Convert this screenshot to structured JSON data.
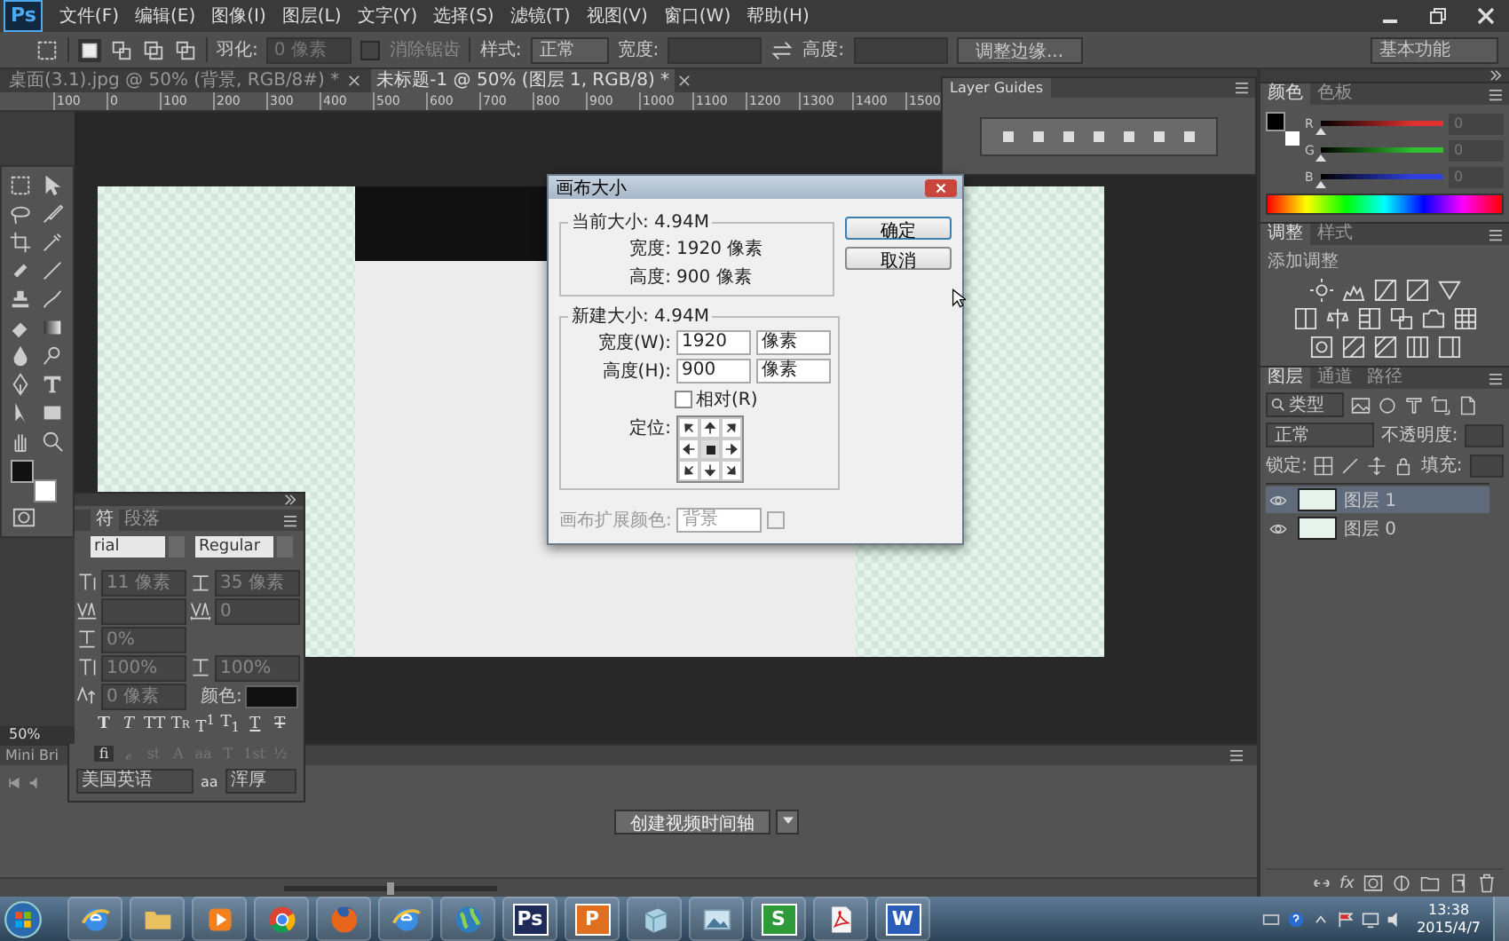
{
  "app_logo": "Ps",
  "menu": [
    "文件(F)",
    "编辑(E)",
    "图像(I)",
    "图层(L)",
    "文字(Y)",
    "选择(S)",
    "滤镜(T)",
    "视图(V)",
    "窗口(W)",
    "帮助(H)"
  ],
  "options_bar": {
    "selection_modes": [
      {
        "selected": true
      },
      {
        "selected": false
      },
      {
        "selected": false
      },
      {
        "selected": false
      }
    ],
    "feather_label": "羽化:",
    "feather_value": "0 像素",
    "antialias": {
      "label": "消除锯齿",
      "checked": false,
      "disabled": true
    },
    "style_label": "样式:",
    "style_value": "正常",
    "width_label": "宽度:",
    "height_label": "高度:",
    "refine_button": "调整边缘...",
    "workspace": "基本功能"
  },
  "doc_tabs": [
    {
      "title": "桌面(3.1).jpg @ 50% (背景, RGB/8#) *",
      "selected": false
    },
    {
      "title": "未标题-1 @ 50% (图层 1, RGB/8) *",
      "selected": true
    }
  ],
  "ruler": [
    "100",
    "0",
    "100",
    "200",
    "300",
    "400",
    "500",
    "600",
    "700",
    "800",
    "900",
    "1000",
    "1100",
    "1200",
    "1300",
    "1400",
    "1500"
  ],
  "zoom_level": "50%",
  "layer_guides": {
    "title": "Layer Guides"
  },
  "dialog": {
    "title": "画布大小",
    "current_size": "当前大小: 4.94M",
    "current_width_label": "宽度:",
    "current_width": "1920 像素",
    "current_height_label": "高度:",
    "current_height": "900 像素",
    "new_size": "新建大小: 4.94M",
    "width_label": "宽度(W):",
    "width_value": "1920",
    "width_unit": "像素",
    "height_label": "高度(H):",
    "height_value": "900",
    "height_unit": "像素",
    "relative": {
      "label": "相对(R)",
      "checked": false
    },
    "anchor_label": "定位:",
    "anchor": [
      {
        "selected": false
      },
      {
        "selected": false
      },
      {
        "selected": false
      },
      {
        "selected": false
      },
      {
        "selected": true
      },
      {
        "selected": false
      },
      {
        "selected": false
      },
      {
        "selected": false
      },
      {
        "selected": false
      }
    ],
    "extension_label": "画布扩展颜色:",
    "extension_value": "背景",
    "extension_disabled": true,
    "ok_button": "确定",
    "cancel_button": "取消"
  },
  "character_panel": {
    "tabs": [
      {
        "label": "符",
        "selected": true
      },
      {
        "label": "段落",
        "selected": false
      }
    ],
    "font_family": "rial",
    "font_style": "Regular",
    "font_size": "11 像素",
    "leading": "35 像素",
    "tracking": "0",
    "proportional_spacing": "0%",
    "vertical_scale": "100%",
    "horizontal_scale": "100%",
    "baseline_shift": "0 像素",
    "color_label": "颜色:",
    "style_buttons": [
      {
        "label": "T",
        "kind": "bold"
      },
      {
        "label": "T",
        "kind": "italic"
      },
      {
        "label": "TT",
        "kind": "caps"
      },
      {
        "label": "Tr",
        "kind": "smallcaps"
      },
      {
        "label": "T$^{1}$",
        "kind": "super"
      },
      {
        "label": "T$_{1}$",
        "kind": "sub"
      },
      {
        "label": "T",
        "kind": "underline"
      },
      {
        "label": "T",
        "kind": "strike"
      }
    ],
    "opentype_buttons": [
      {
        "label": "fi",
        "disabled": false
      },
      {
        "label": "ℴ",
        "disabled": true
      },
      {
        "label": "st",
        "disabled": true
      },
      {
        "label": "A",
        "disabled": true
      },
      {
        "label": "aa",
        "disabled": true
      },
      {
        "label": "T",
        "disabled": true
      },
      {
        "label": "1st",
        "disabled": true
      },
      {
        "label": "½",
        "disabled": true
      }
    ],
    "language": "美国英语",
    "antialias_icon": "aa",
    "antialias": "浑厚"
  },
  "color_panel": {
    "tabs": [
      {
        "label": "颜色",
        "selected": true
      },
      {
        "label": "色板",
        "selected": false
      }
    ],
    "channels": [
      {
        "label": "R",
        "color": "#e03030",
        "value": "0",
        "level": 0
      },
      {
        "label": "G",
        "color": "#30c030",
        "value": "0",
        "level": 0
      },
      {
        "label": "B",
        "color": "#3040e0",
        "value": "0",
        "level": 0
      }
    ]
  },
  "adjustments_panel": {
    "tabs": [
      {
        "label": "调整",
        "selected": true
      },
      {
        "label": "样式",
        "selected": false
      }
    ],
    "hint": "添加调整"
  },
  "layers_panel": {
    "tabs": [
      {
        "label": "图层",
        "selected": true
      },
      {
        "label": "通道",
        "selected": false
      },
      {
        "label": "路径",
        "selected": false
      }
    ],
    "filter": "类型",
    "blend_mode": "正常",
    "opacity_label": "不透明度:",
    "lock_label": "锁定:",
    "fill_label": "填充:",
    "layers": [
      {
        "name": "图层 1",
        "selected": true,
        "visible": true
      },
      {
        "name": "图层 0",
        "selected": false,
        "visible": true
      }
    ],
    "fx_label": "fx"
  },
  "timeline": {
    "tab": "Mini Bri",
    "create_button": "创建视频时间轴",
    "zoom_slider": {
      "level": 0.5
    }
  },
  "taskbar": {
    "apps": [
      {
        "kind": "browser-e"
      },
      {
        "kind": "folder"
      },
      {
        "kind": "media"
      },
      {
        "kind": "chrome"
      },
      {
        "kind": "firefox"
      },
      {
        "kind": "browser-e"
      },
      {
        "kind": "globe"
      },
      {
        "kind": "letter",
        "label": "Ps",
        "color": "#1c2b5a"
      },
      {
        "kind": "letter",
        "label": "P",
        "color": "#e07020"
      },
      {
        "kind": "cube"
      },
      {
        "kind": "picture"
      },
      {
        "kind": "letter",
        "label": "S",
        "color": "#2e9a3a"
      },
      {
        "kind": "pdf"
      },
      {
        "kind": "letter",
        "label": "W",
        "color": "#2b5cb8"
      }
    ],
    "time": "13:38",
    "date": "2015/4/7"
  }
}
